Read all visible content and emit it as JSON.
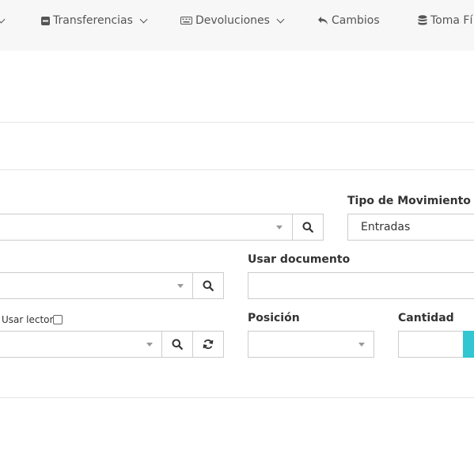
{
  "nav": {
    "items": [
      {
        "label": "Transferencias",
        "icon": "minus-square-icon",
        "has_dropdown": true
      },
      {
        "label": "Devoluciones",
        "icon": "keyboard-icon",
        "has_dropdown": true
      },
      {
        "label": "Cambios",
        "icon": "reply-icon",
        "has_dropdown": false
      },
      {
        "label": "Toma Fí",
        "icon": "database-icon",
        "has_dropdown": false
      }
    ]
  },
  "form": {
    "tipo_movimiento": {
      "label": "Tipo de Movimiento",
      "value": "Entradas"
    },
    "usar_documento": {
      "label": "Usar documento",
      "value": ""
    },
    "usar_lector": {
      "label": "Usar lector",
      "checked": false
    },
    "posicion": {
      "label": "Posición",
      "value": ""
    },
    "cantidad": {
      "label": "Cantidad",
      "value": ""
    }
  },
  "colors": {
    "accent": "#32c5d2",
    "nav_bg": "#f7f7f7",
    "border": "#cccccc"
  }
}
